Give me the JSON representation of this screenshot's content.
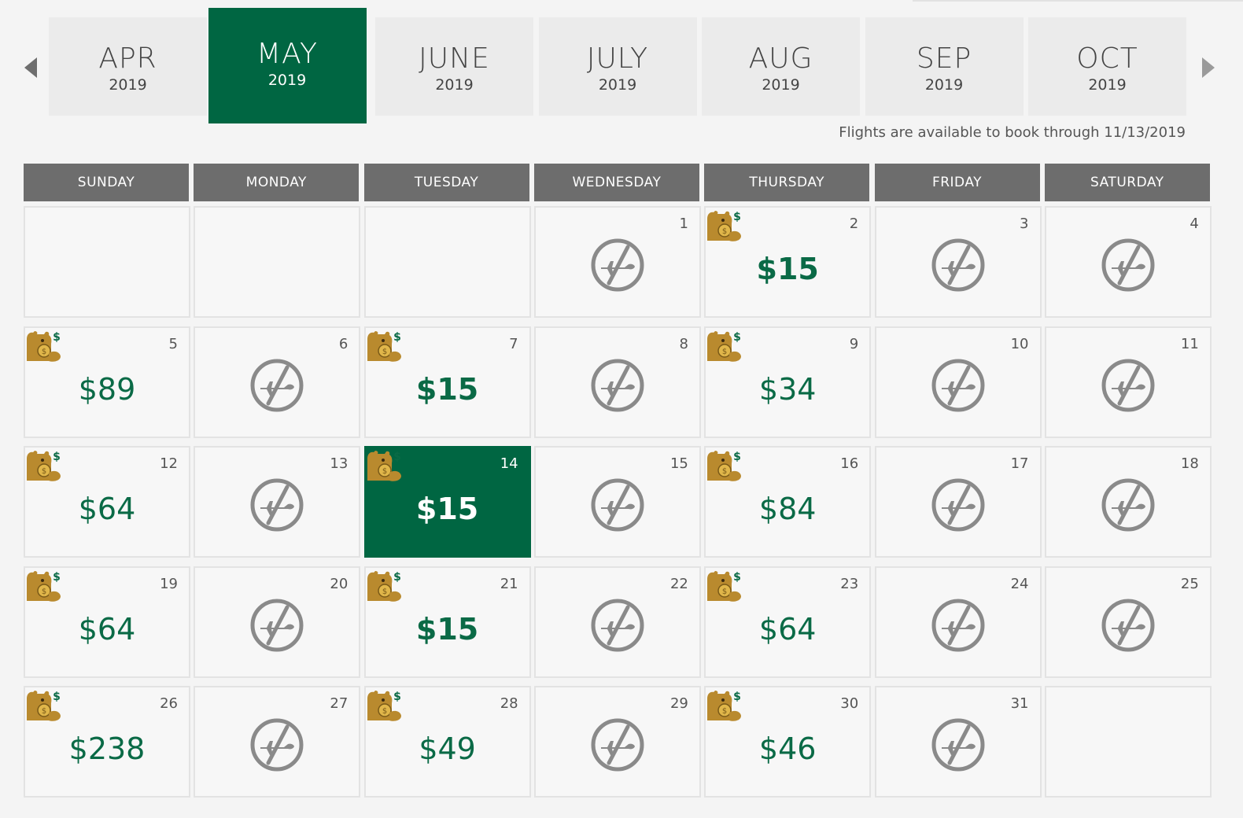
{
  "months": [
    {
      "m": "APR",
      "y": "2019"
    },
    {
      "m": "MAY",
      "y": "2019",
      "active": true
    },
    {
      "m": "JUNE",
      "y": "2019"
    },
    {
      "m": "JULY",
      "y": "2019"
    },
    {
      "m": "AUG",
      "y": "2019"
    },
    {
      "m": "SEP",
      "y": "2019"
    },
    {
      "m": "OCT",
      "y": "2019"
    }
  ],
  "note": "Flights are available to book through 11/13/2019",
  "weekdays": [
    "SUNDAY",
    "MONDAY",
    "TUESDAY",
    "WEDNESDAY",
    "THURSDAY",
    "FRIDAY",
    "SATURDAY"
  ],
  "first_weekday": 3,
  "days": [
    {
      "d": "1"
    },
    {
      "d": "2",
      "price": "$15",
      "bear": true,
      "bold": true
    },
    {
      "d": "3"
    },
    {
      "d": "4"
    },
    {
      "d": "5",
      "price": "$89",
      "bear": true
    },
    {
      "d": "6"
    },
    {
      "d": "7",
      "price": "$15",
      "bear": true,
      "bold": true
    },
    {
      "d": "8"
    },
    {
      "d": "9",
      "price": "$34",
      "bear": true
    },
    {
      "d": "10"
    },
    {
      "d": "11"
    },
    {
      "d": "12",
      "price": "$64",
      "bear": true
    },
    {
      "d": "13"
    },
    {
      "d": "14",
      "price": "$15",
      "bear": true,
      "bold": true,
      "selected": true
    },
    {
      "d": "15"
    },
    {
      "d": "16",
      "price": "$84",
      "bear": true
    },
    {
      "d": "17"
    },
    {
      "d": "18"
    },
    {
      "d": "19",
      "price": "$64",
      "bear": true
    },
    {
      "d": "20"
    },
    {
      "d": "21",
      "price": "$15",
      "bear": true,
      "bold": true
    },
    {
      "d": "22"
    },
    {
      "d": "23",
      "price": "$64",
      "bear": true
    },
    {
      "d": "24"
    },
    {
      "d": "25"
    },
    {
      "d": "26",
      "price": "$238",
      "bear": true
    },
    {
      "d": "27"
    },
    {
      "d": "28",
      "price": "$49",
      "bear": true
    },
    {
      "d": "29"
    },
    {
      "d": "30",
      "price": "$46",
      "bear": true
    },
    {
      "d": "31"
    }
  ],
  "icons": {
    "no_flight": "no-flight-icon",
    "deal": "bear-money-icon",
    "prev": "prev-arrow-icon",
    "next": "next-arrow-icon"
  },
  "colors": {
    "accent": "#006642",
    "price": "#0a6a46",
    "header": "#6d6d6d"
  }
}
